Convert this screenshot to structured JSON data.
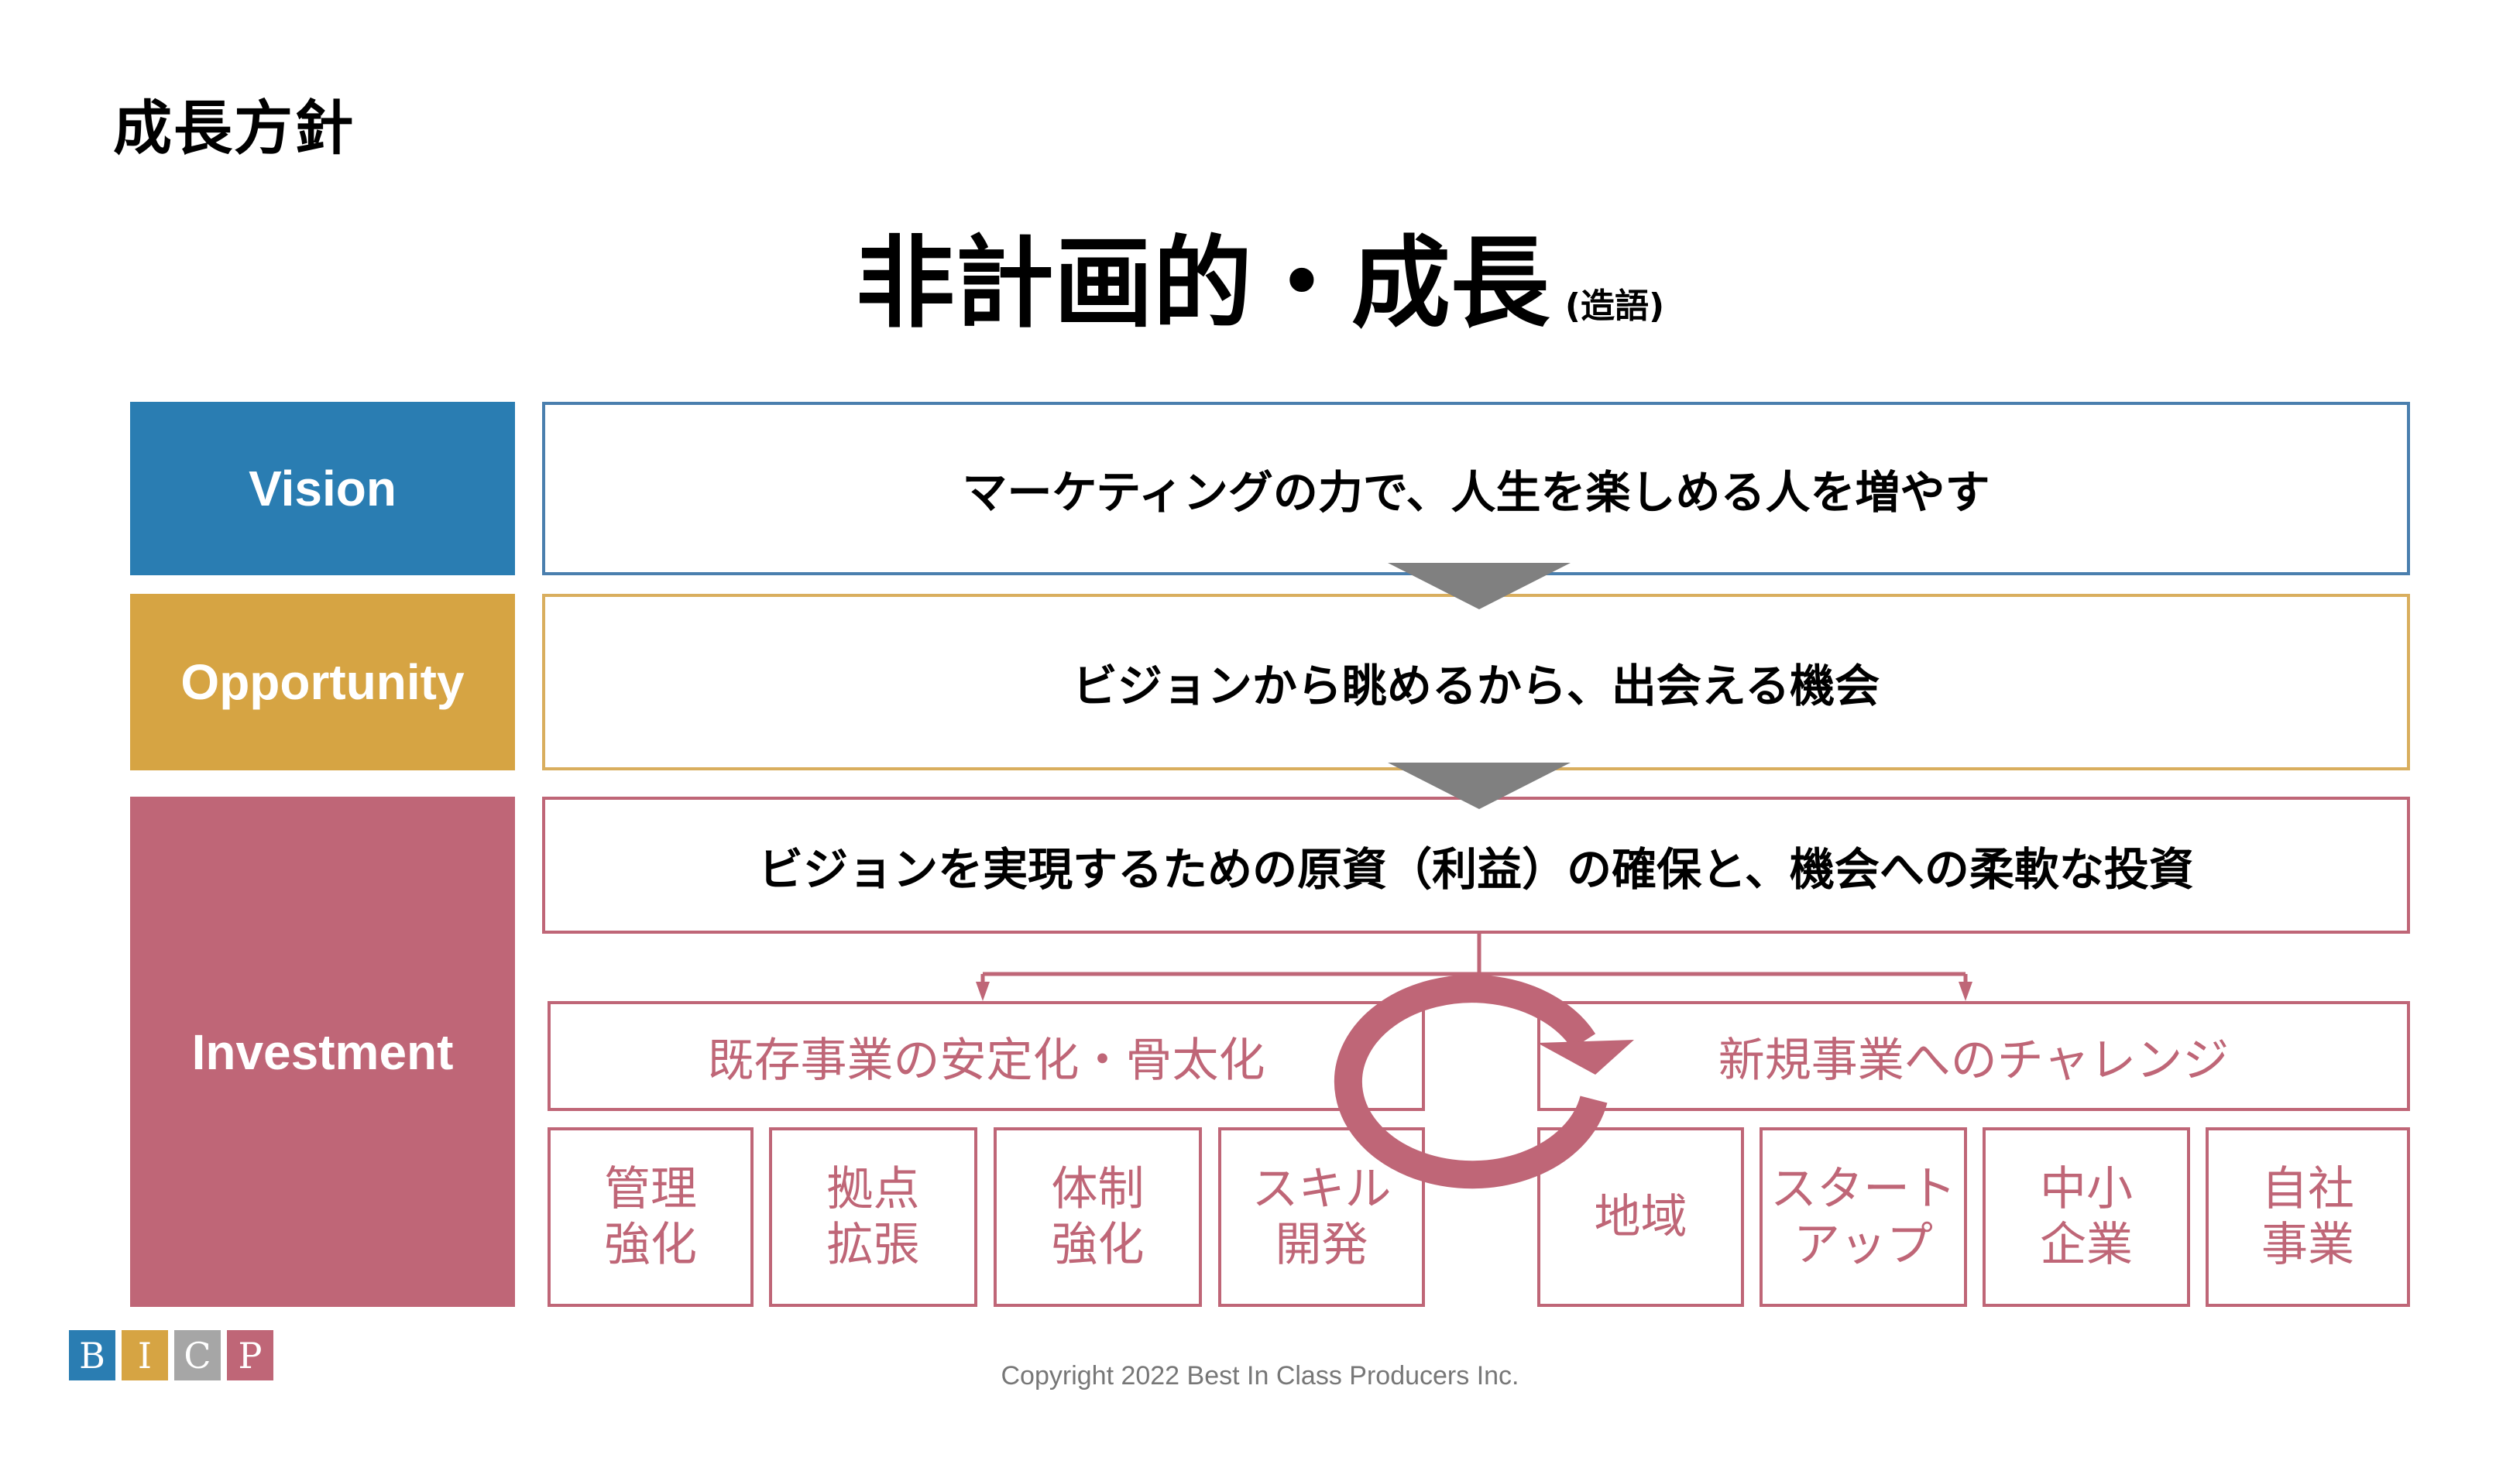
{
  "page_title": "成長方針",
  "main_title": {
    "text": "非計画的・成長",
    "note": "(造語)"
  },
  "colors": {
    "vision": "#2a7db2",
    "opportunity": "#d6a443",
    "investment": "#bf6677",
    "arrow_gray": "#808080",
    "logo_gray": "#a6a6a6"
  },
  "rows": {
    "vision": {
      "label": "Vision",
      "statement": "マーケティングの力で、人生を楽しめる人を増やす"
    },
    "opportunity": {
      "label": "Opportunity",
      "statement": "ビジョンから眺めるから、出会える機会"
    },
    "investment": {
      "label": "Investment",
      "statement": "ビジョンを実現するための原資（利益）の確保と、機会への柔軟な投資",
      "groups": [
        {
          "title": "既存事業の安定化・骨太化",
          "items": [
            "管理\n強化",
            "拠点\n拡張",
            "体制\n強化",
            "スキル\n開発"
          ]
        },
        {
          "title": "新規事業へのチャレンジ",
          "items": [
            "地域",
            "スタート\nアップ",
            "中小\n企業",
            "自社\n事業"
          ]
        }
      ]
    }
  },
  "footer": {
    "logo_letters": [
      "B",
      "I",
      "C",
      "P"
    ],
    "copyright": "Copyright 2022 Best In Class Producers Inc."
  }
}
